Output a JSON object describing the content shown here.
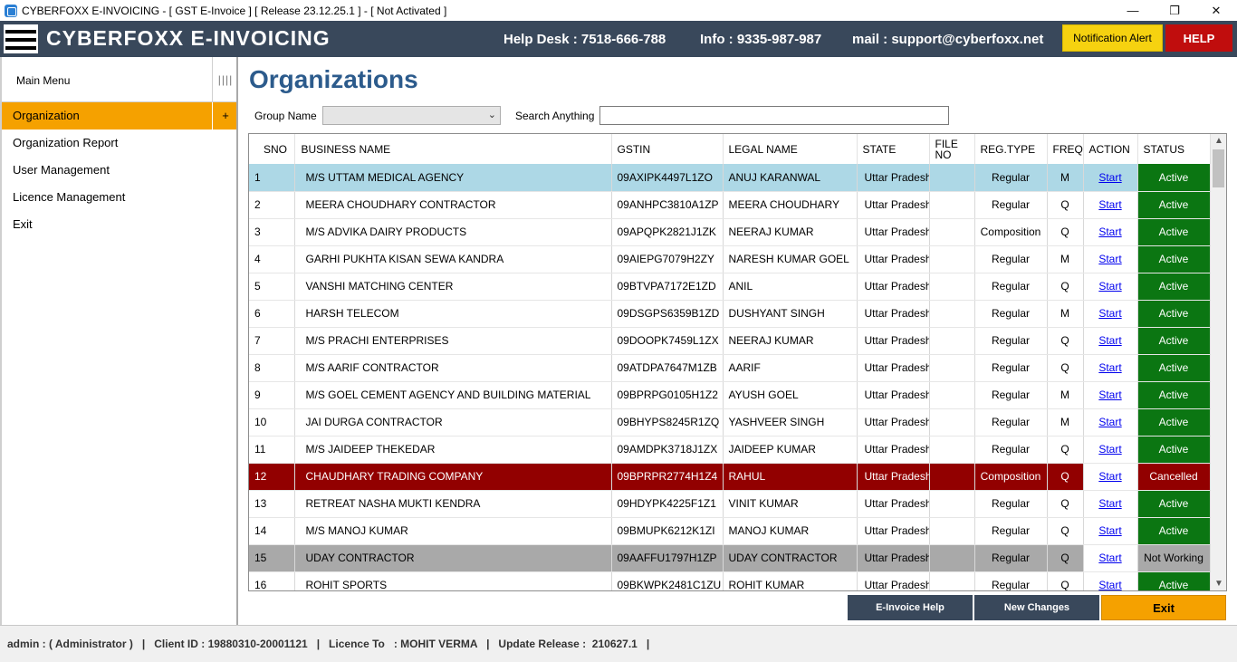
{
  "window": {
    "title": "CYBERFOXX E-INVOICING - [ GST E-Invoice ] [ Release 23.12.25.1 ] - [ Not Activated ]",
    "minimize": "—",
    "restore": "❐",
    "close": "✕"
  },
  "header": {
    "brand": "CYBERFOXX E-INVOICING",
    "helpdesk": "Help Desk : 7518-666-788",
    "info": "Info : 9335-987-987",
    "mail": "mail : support@cyberfoxx.net",
    "notification_label": "Notification Alert",
    "help_label": "HELP",
    "colors": {
      "bar": "#39485b",
      "notification": "#f6d210",
      "help": "#c00d0d"
    }
  },
  "sidebar": {
    "title": "Main Menu",
    "grip": "||||",
    "items": [
      {
        "label": "Organization",
        "expander": "+"
      },
      {
        "label": "Organization Report"
      },
      {
        "label": "User Management"
      },
      {
        "label": "Licence Management"
      },
      {
        "label": "Exit"
      }
    ]
  },
  "main": {
    "title": "Organizations",
    "group_name_label": "Group Name",
    "group_name_value": "",
    "search_label": "Search Anything",
    "search_value": ""
  },
  "grid": {
    "columns": [
      "SNO",
      "BUSINESS NAME",
      "GSTIN",
      "LEGAL NAME",
      "STATE",
      "FILE NO",
      "REG.TYPE",
      "FREQ",
      "ACTION",
      "STATUS"
    ],
    "rows": [
      {
        "sno": "1",
        "business": "M/S UTTAM MEDICAL AGENCY",
        "gstin": "09AXIPK4497L1ZO",
        "legal": "ANUJ  KARANWAL",
        "state": "Uttar Pradesh",
        "file": "",
        "reg": "Regular",
        "freq": "M",
        "action": "Start",
        "status": "Active"
      },
      {
        "sno": "2",
        "business": "MEERA CHOUDHARY CONTRACTOR",
        "gstin": "09ANHPC3810A1ZP",
        "legal": "MEERA  CHOUDHARY",
        "state": "Uttar Pradesh",
        "file": "",
        "reg": "Regular",
        "freq": "Q",
        "action": "Start",
        "status": "Active"
      },
      {
        "sno": "3",
        "business": "M/S ADVIKA DAIRY PRODUCTS",
        "gstin": "09APQPK2821J1ZK",
        "legal": "NEERAJ  KUMAR",
        "state": "Uttar Pradesh",
        "file": "",
        "reg": "Composition",
        "freq": "Q",
        "action": "Start",
        "status": "Active"
      },
      {
        "sno": "4",
        "business": "GARHI PUKHTA KISAN SEWA KANDRA",
        "gstin": "09AIEPG7079H2ZY",
        "legal": "NARESH KUMAR GOEL",
        "state": "Uttar Pradesh",
        "file": "",
        "reg": "Regular",
        "freq": "M",
        "action": "Start",
        "status": "Active"
      },
      {
        "sno": "5",
        "business": "VANSHI MATCHING CENTER",
        "gstin": "09BTVPA7172E1ZD",
        "legal": "ANIL",
        "state": "Uttar Pradesh",
        "file": "",
        "reg": "Regular",
        "freq": "Q",
        "action": "Start",
        "status": "Active"
      },
      {
        "sno": "6",
        "business": "HARSH TELECOM",
        "gstin": "09DSGPS6359B1ZD",
        "legal": "DUSHYANT SINGH",
        "state": "Uttar Pradesh",
        "file": "",
        "reg": "Regular",
        "freq": "M",
        "action": "Start",
        "status": "Active"
      },
      {
        "sno": "7",
        "business": "M/S PRACHI ENTERPRISES",
        "gstin": "09DOOPK7459L1ZX",
        "legal": "NEERAJ KUMAR",
        "state": "Uttar Pradesh",
        "file": "",
        "reg": "Regular",
        "freq": "Q",
        "action": "Start",
        "status": "Active"
      },
      {
        "sno": "8",
        "business": "M/S AARIF CONTRACTOR",
        "gstin": "09ATDPA7647M1ZB",
        "legal": "AARIF",
        "state": "Uttar Pradesh",
        "file": "",
        "reg": "Regular",
        "freq": "Q",
        "action": "Start",
        "status": "Active"
      },
      {
        "sno": "9",
        "business": "M/S GOEL CEMENT AGENCY AND BUILDING MATERIAL",
        "gstin": "09BPRPG0105H1Z2",
        "legal": "AYUSH  GOEL",
        "state": "Uttar Pradesh",
        "file": "",
        "reg": "Regular",
        "freq": "M",
        "action": "Start",
        "status": "Active"
      },
      {
        "sno": "10",
        "business": "JAI DURGA CONTRACTOR",
        "gstin": "09BHYPS8245R1ZQ",
        "legal": "YASHVEER  SINGH",
        "state": "Uttar Pradesh",
        "file": "",
        "reg": "Regular",
        "freq": "M",
        "action": "Start",
        "status": "Active"
      },
      {
        "sno": "11",
        "business": "M/S JAIDEEP THEKEDAR",
        "gstin": "09AMDPK3718J1ZX",
        "legal": "JAIDEEP  KUMAR",
        "state": "Uttar Pradesh",
        "file": "",
        "reg": "Regular",
        "freq": "Q",
        "action": "Start",
        "status": "Active"
      },
      {
        "sno": "12",
        "business": "CHAUDHARY TRADING COMPANY",
        "gstin": "09BPRPR2774H1Z4",
        "legal": "RAHUL",
        "state": "Uttar Pradesh",
        "file": "",
        "reg": "Composition",
        "freq": "Q",
        "action": "Start",
        "status": "Cancelled"
      },
      {
        "sno": "13",
        "business": "RETREAT NASHA MUKTI KENDRA",
        "gstin": "09HDYPK4225F1Z1",
        "legal": "VINIT KUMAR",
        "state": "Uttar Pradesh",
        "file": "",
        "reg": "Regular",
        "freq": "Q",
        "action": "Start",
        "status": "Active"
      },
      {
        "sno": "14",
        "business": "M/S MANOJ KUMAR",
        "gstin": "09BMUPK6212K1ZI",
        "legal": "MANOJ  KUMAR",
        "state": "Uttar Pradesh",
        "file": "",
        "reg": "Regular",
        "freq": "Q",
        "action": "Start",
        "status": "Active"
      },
      {
        "sno": "15",
        "business": "UDAY CONTRACTOR",
        "gstin": "09AAFFU1797H1ZP",
        "legal": "UDAY CONTRACTOR",
        "state": "Uttar Pradesh",
        "file": "",
        "reg": "Regular",
        "freq": "Q",
        "action": "Start",
        "status": "Not Working"
      },
      {
        "sno": "16",
        "business": "ROHIT SPORTS",
        "gstin": "09BKWPK2481C1ZU",
        "legal": "ROHIT KUMAR",
        "state": "Uttar Pradesh",
        "file": "",
        "reg": "Regular",
        "freq": "Q",
        "action": "Start",
        "status": "Active"
      }
    ],
    "scroll_up": "▲",
    "scroll_down": "▼"
  },
  "buttons": {
    "einvoice_help": "E-Invoice Help",
    "new_changes": "New Changes",
    "exit": "Exit"
  },
  "statusbar": {
    "text": "admin : ( Administrator )   |   Client ID : 19880310-20001121   |   Licence To   : MOHIT VERMA   |   Update Release :  210627.1   |"
  }
}
